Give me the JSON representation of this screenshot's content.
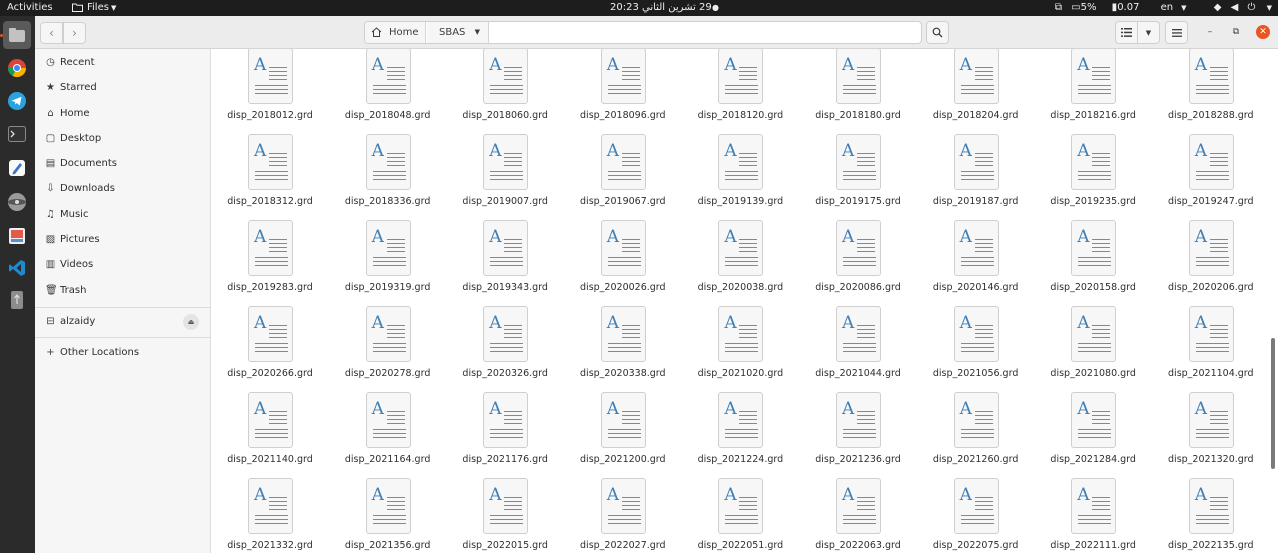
{
  "topbar": {
    "activities": "Activities",
    "app_menu": "Files",
    "clock": "20:23",
    "date": "29 تشرين الثاني",
    "battery": "5%",
    "cpu": "0.07",
    "lang": "en"
  },
  "dock": {
    "items": [
      "files-icon",
      "chrome-icon",
      "telegram-icon",
      "terminal-icon",
      "text-editor-icon",
      "disk-icon",
      "image-viewer-icon",
      "vscode-icon",
      "usb-drive-icon"
    ]
  },
  "header": {
    "path": [
      "Home",
      "SBAS"
    ]
  },
  "sidebar": {
    "places": [
      {
        "label": "Recent",
        "icon": "clock-icon"
      },
      {
        "label": "Starred",
        "icon": "star-icon"
      },
      {
        "label": "Home",
        "icon": "home-icon"
      },
      {
        "label": "Desktop",
        "icon": "desktop-icon"
      },
      {
        "label": "Documents",
        "icon": "document-icon"
      },
      {
        "label": "Downloads",
        "icon": "download-icon"
      },
      {
        "label": "Music",
        "icon": "music-icon"
      },
      {
        "label": "Pictures",
        "icon": "picture-icon"
      },
      {
        "label": "Videos",
        "icon": "video-icon"
      },
      {
        "label": "Trash",
        "icon": "trash-icon"
      }
    ],
    "device": {
      "label": "alzaidy",
      "icon": "drive-icon"
    },
    "other": {
      "label": "Other Locations",
      "icon": "plus-icon"
    }
  },
  "files": [
    "disp_2018012.grd",
    "disp_2018048.grd",
    "disp_2018060.grd",
    "disp_2018096.grd",
    "disp_2018120.grd",
    "disp_2018180.grd",
    "disp_2018204.grd",
    "disp_2018216.grd",
    "disp_2018288.grd",
    "disp_2018312.grd",
    "disp_2018336.grd",
    "disp_2019007.grd",
    "disp_2019067.grd",
    "disp_2019139.grd",
    "disp_2019175.grd",
    "disp_2019187.grd",
    "disp_2019235.grd",
    "disp_2019247.grd",
    "disp_2019283.grd",
    "disp_2019319.grd",
    "disp_2019343.grd",
    "disp_2020026.grd",
    "disp_2020038.grd",
    "disp_2020086.grd",
    "disp_2020146.grd",
    "disp_2020158.grd",
    "disp_2020206.grd",
    "disp_2020266.grd",
    "disp_2020278.grd",
    "disp_2020326.grd",
    "disp_2020338.grd",
    "disp_2021020.grd",
    "disp_2021044.grd",
    "disp_2021056.grd",
    "disp_2021080.grd",
    "disp_2021104.grd",
    "disp_2021140.grd",
    "disp_2021164.grd",
    "disp_2021176.grd",
    "disp_2021200.grd",
    "disp_2021224.grd",
    "disp_2021236.grd",
    "disp_2021260.grd",
    "disp_2021284.grd",
    "disp_2021320.grd",
    "disp_2021332.grd",
    "disp_2021356.grd",
    "disp_2022015.grd",
    "disp_2022027.grd",
    "disp_2022051.grd",
    "disp_2022063.grd",
    "disp_2022075.grd",
    "disp_2022111.grd",
    "disp_2022135.grd"
  ],
  "scroll": {
    "position_fraction": 0.72,
    "visible_fraction": 0.26
  }
}
